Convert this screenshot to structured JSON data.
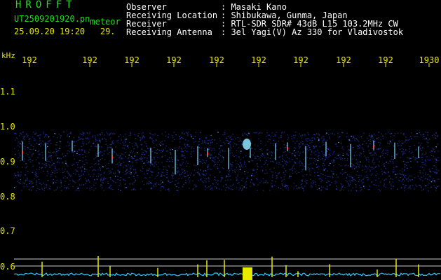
{
  "header": {
    "title": "HROFFT",
    "filename": "UT2509201920.pn",
    "filename_suffix": "meteor",
    "datetime": "25.09.20 19:20",
    "datetime_extra": "29"
  },
  "meta": [
    {
      "label": "Observer",
      "value": ": Masaki Kano"
    },
    {
      "label": "Receiving Location",
      "value": ": Shibukawa, Gunma, Japan"
    },
    {
      "label": "Receiver",
      "value": ": RTL-SDR SDR# 43dB L15 103.2MHz CW"
    },
    {
      "label": "Receiving Antenna",
      "value": ": 3el Yagi(V) Az 330 for Vladivostok"
    }
  ],
  "axis": {
    "y_unit": "kHz",
    "x_ticks": [
      "192",
      "192",
      "192",
      "192",
      "192",
      "192",
      "192",
      "192",
      "192",
      "1930"
    ],
    "y_ticks": [
      "1.1",
      "1.0",
      "0.9",
      "0.8",
      "0.7",
      "0.6"
    ]
  },
  "colors": {
    "text_green": "#22dd22",
    "text_yellow": "#e8e800",
    "text_white": "#ffffff",
    "noise": "#1a2a8a",
    "echo": "#7fd8ff",
    "level_trace": "#33ccff",
    "level_spike": "#e8e800"
  }
}
